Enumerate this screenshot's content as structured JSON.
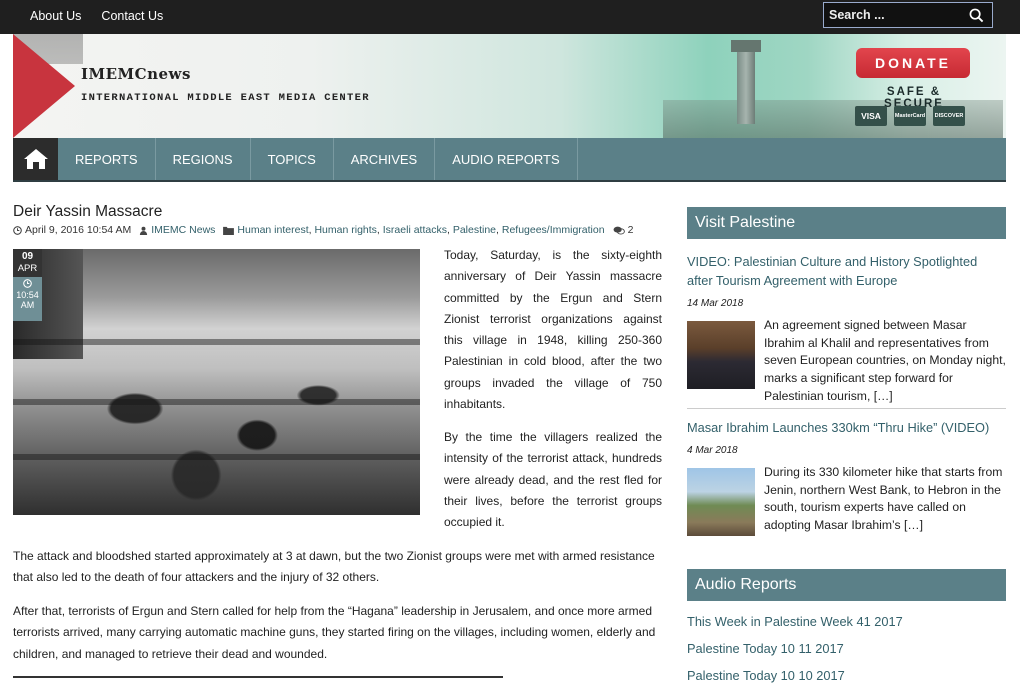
{
  "topbar": {
    "links": [
      "About Us",
      "Contact Us"
    ],
    "search_placeholder": "Search ..."
  },
  "banner": {
    "logo_title": "IMEMCnews",
    "logo_subtitle": "INTERNATIONAL MIDDLE EAST MEDIA CENTER",
    "donate_label": "DONATE",
    "safe_label": "SAFE & SECURE",
    "cards": [
      "VISA",
      "MasterCard",
      "DISCOVER"
    ]
  },
  "nav": {
    "items": [
      "REPORTS",
      "REGIONS",
      "TOPICS",
      "ARCHIVES",
      "AUDIO REPORTS"
    ]
  },
  "article": {
    "title": "Deir Yassin Massacre",
    "date": "April 9, 2016 10:54 AM",
    "author": "IMEMC News",
    "categories": [
      "Human interest",
      "Human rights",
      "Israeli attacks",
      "Palestine",
      "Refugees/Immigration"
    ],
    "comments": "2",
    "badge_day": "09",
    "badge_month": "APR",
    "badge_time": "10:54",
    "badge_ampm": "AM",
    "paragraphs": [
      "Today, Saturday, is the sixty-eighth anniversary of Deir Yassin massacre committed by the Ergun and Stern Zionist terrorist organizations against this village in 1948, killing 250-360 Palestinian in cold blood, after the two groups invaded the village of 750 inhabitants.",
      "By the time the villagers realized the intensity of the terrorist attack, hundreds were already dead, and the rest fled for their lives, before the terrorist groups occupied it.",
      "The attack and bloodshed started approximately at 3 at dawn, but the two Zionist groups were met with armed resistance that also led to the death of four attackers and the injury of 32 others.",
      "After that, terrorists of Ergun and Stern called for help from the “Hagana” leadership in Jerusalem, and once more armed terrorists arrived, many carrying automatic machine guns, they started firing on the villages, including women, elderly and children, and managed to retrieve their dead and wounded."
    ]
  },
  "sidebar": {
    "visit_heading": "Visit Palestine",
    "posts": [
      {
        "title": "VIDEO: Palestinian Culture and History Spotlighted after Tourism Agreement with Europe",
        "date": "14 Mar 2018",
        "excerpt": "An agreement signed between Masar Ibrahim al Khalil and representatives from seven European countries, on Monday night, marks a significant step forward for Palestinian tourism, […]"
      },
      {
        "title": "Masar Ibrahim Launches 330km “Thru Hike” (VIDEO)",
        "date": "4 Mar 2018",
        "excerpt": "During its 330 kilometer hike that starts from Jenin, northern West Bank, to Hebron in the south, tourism experts have called on adopting Masar Ibrahim’s […]"
      }
    ],
    "audio_heading": "Audio Reports",
    "audio_links": [
      "This Week in Palestine Week 41 2017",
      "Palestine Today 10 11 2017",
      "Palestine Today 10 10 2017"
    ]
  }
}
